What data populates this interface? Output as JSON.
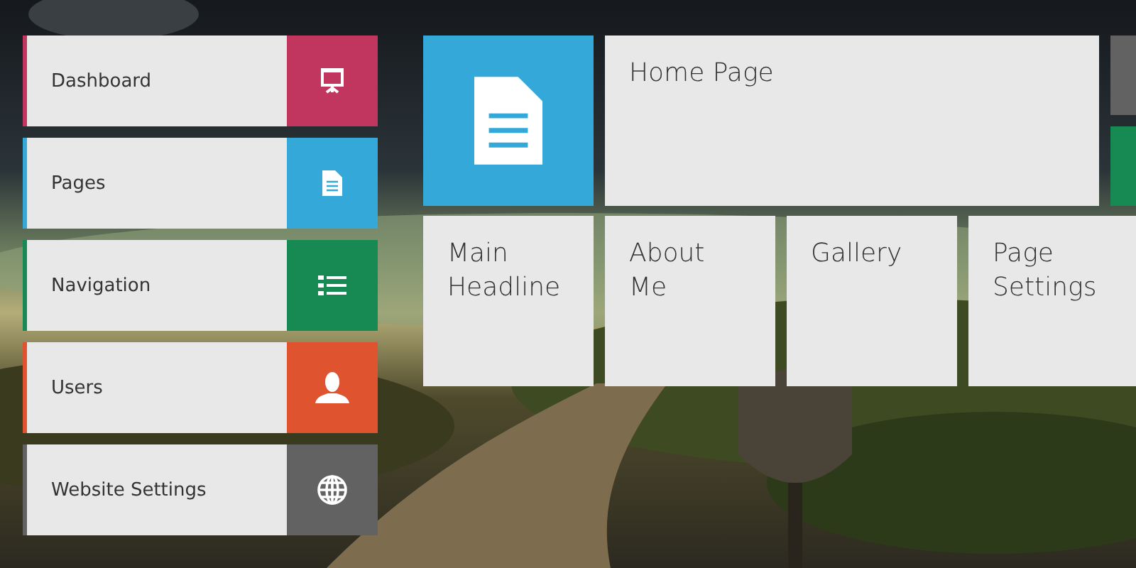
{
  "menu": [
    {
      "label": "Dashboard",
      "color": "#c1365f"
    },
    {
      "label": "Pages",
      "color": "#34a9d9"
    },
    {
      "label": "Navigation",
      "color": "#168a52"
    },
    {
      "label": "Users",
      "color": "#e0532f"
    },
    {
      "label": "Website Settings",
      "color": "#626262"
    }
  ],
  "tiles": {
    "rows": [
      [
        {
          "kind": "icon",
          "color": "#34a9d9"
        },
        {
          "kind": "wide",
          "label": "Home Page"
        },
        {
          "kind": "stack",
          "tiles": [
            {
              "color": "#626262"
            },
            {
              "color": "#168a52"
            }
          ]
        }
      ],
      [
        {
          "kind": "text",
          "label": "Main Headline"
        },
        {
          "kind": "text",
          "label": "About Me"
        },
        {
          "kind": "text",
          "label": "Gallery"
        },
        {
          "kind": "text",
          "label": "Page Settings"
        }
      ]
    ]
  }
}
